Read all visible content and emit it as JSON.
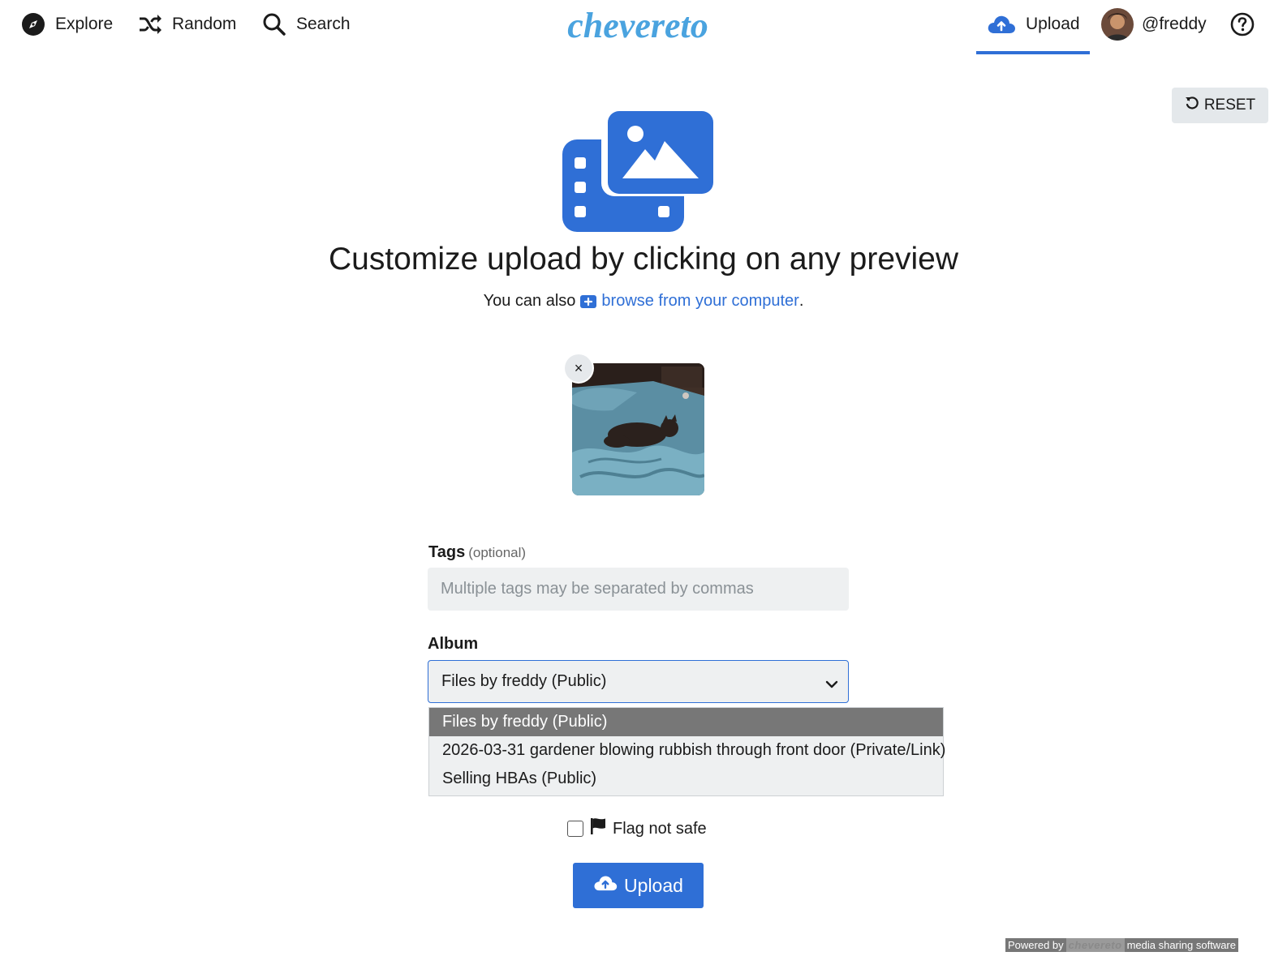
{
  "nav": {
    "explore_label": "Explore",
    "random_label": "Random",
    "search_label": "Search",
    "logo_text": "chevereto",
    "upload_label": "Upload",
    "user_label": "@freddy"
  },
  "reset": {
    "label": "RESET"
  },
  "hero": {
    "headline": "Customize upload by clicking on any preview",
    "sub_prefix": "You can also",
    "browse_link": "browse from your computer",
    "sub_suffix": "."
  },
  "preview": {
    "remove_label": "×"
  },
  "form": {
    "tags_label": "Tags",
    "tags_optional": "(optional)",
    "tags_placeholder": "Multiple tags may be separated by commas",
    "album_label": "Album",
    "album_selected": "Files by freddy (Public)",
    "album_options": [
      "Files by freddy (Public)",
      "2026-03-31 gardener blowing rubbish through front door (Private/Link)",
      "Selling HBAs (Public)"
    ],
    "flag_label": "Flag not safe",
    "upload_button": "Upload"
  },
  "footer": {
    "powered_prefix": "Powered by",
    "powered_brand": "chevereto",
    "powered_suffix": "media sharing software"
  },
  "colors": {
    "accent": "#2f6fd6",
    "logo": "#4aa3df",
    "selected_option": "#777777"
  }
}
